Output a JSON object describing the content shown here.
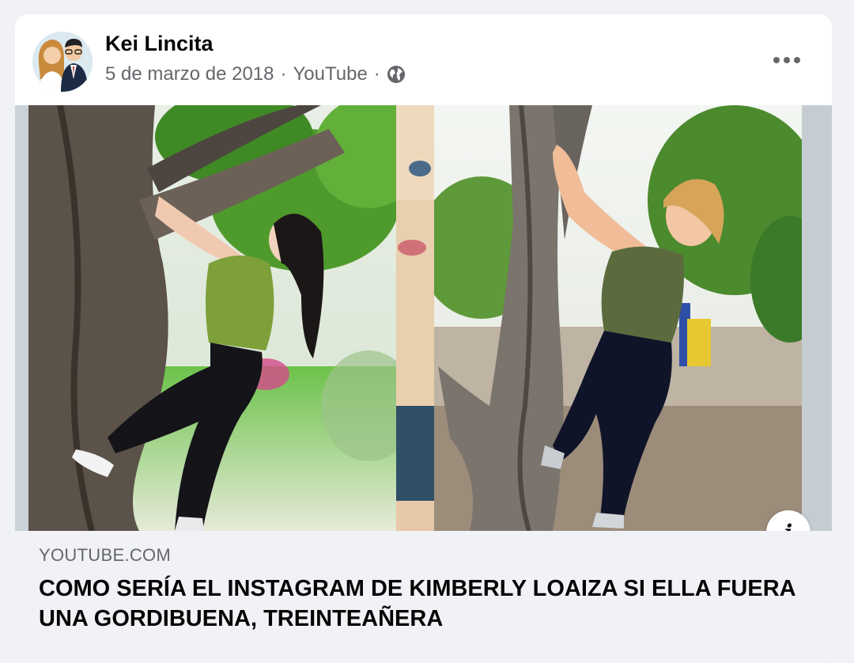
{
  "post": {
    "author": "Kei Lincita",
    "date": "5 de marzo de 2018",
    "separator": "·",
    "source": "YouTube",
    "privacy_icon": "globe-icon",
    "more_icon": "more-options-icon"
  },
  "link": {
    "domain": "YOUTUBE.COM",
    "title": "COMO SERÍA EL INSTAGRAM DE KIMBERLY LOAIZA SI ELLA FUERA UNA GORDIBUENA, TREINTEAÑERA",
    "info_label": "i"
  },
  "colors": {
    "card_bg": "#ffffff",
    "page_bg": "#f0f2f5",
    "secondary_text": "#65676b",
    "primary_text": "#050505"
  }
}
